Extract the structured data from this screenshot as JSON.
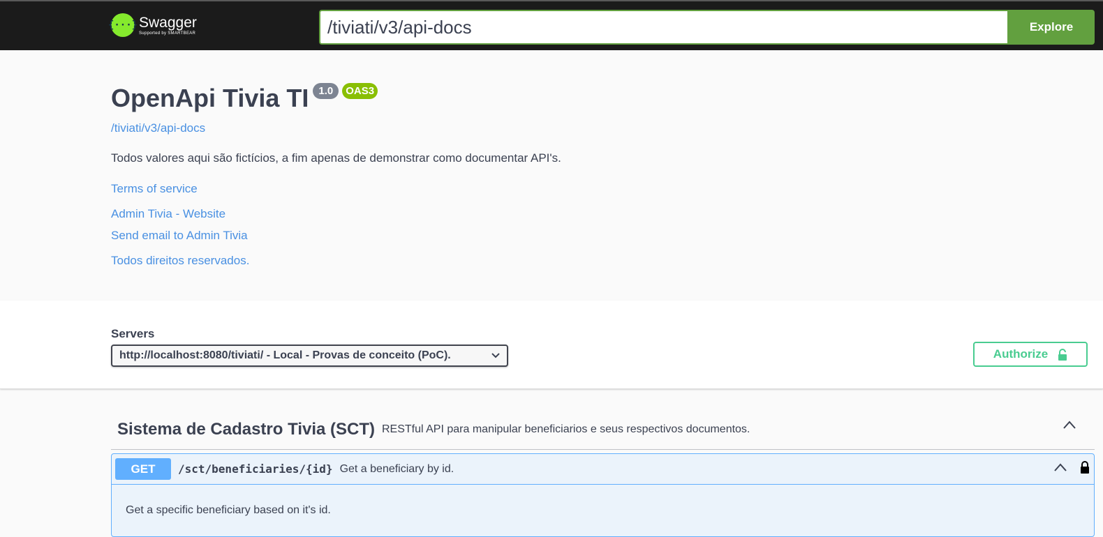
{
  "topbar": {
    "logo_name": "Swagger",
    "logo_sub": "Supported by SMARTBEAR",
    "logo_icon": "{···}",
    "url_value": "/tiviati/v3/api-docs",
    "explore_label": "Explore"
  },
  "info": {
    "title": "OpenApi Tivia TI",
    "version": "1.0",
    "oas": "OAS3",
    "url_link": "/tiviati/v3/api-docs",
    "description": "Todos valores aqui são fictícios, a fim apenas de demonstrar como documentar API's.",
    "terms": "Terms of service",
    "website": "Admin Tivia - Website",
    "email": "Send email to Admin Tivia",
    "license": "Todos direitos reservados."
  },
  "servers": {
    "label": "Servers",
    "selected": "http://localhost:8080/tiviati/ - Local - Provas de conceito (PoC).",
    "authorize_label": "Authorize"
  },
  "tag": {
    "name": "Sistema de Cadastro Tivia (SCT)",
    "description": "RESTful API para manipular beneficiarios e seus respectivos documentos."
  },
  "operation": {
    "method": "GET",
    "path": "/sct/beneficiaries/{id}",
    "summary": "Get a beneficiary by id.",
    "description": "Get a specific beneficiary based on it's id."
  },
  "colors": {
    "accent_green": "#62a03f",
    "get_blue": "#61affe",
    "authorize_green": "#49cc90",
    "oas_badge": "#89bf04"
  }
}
